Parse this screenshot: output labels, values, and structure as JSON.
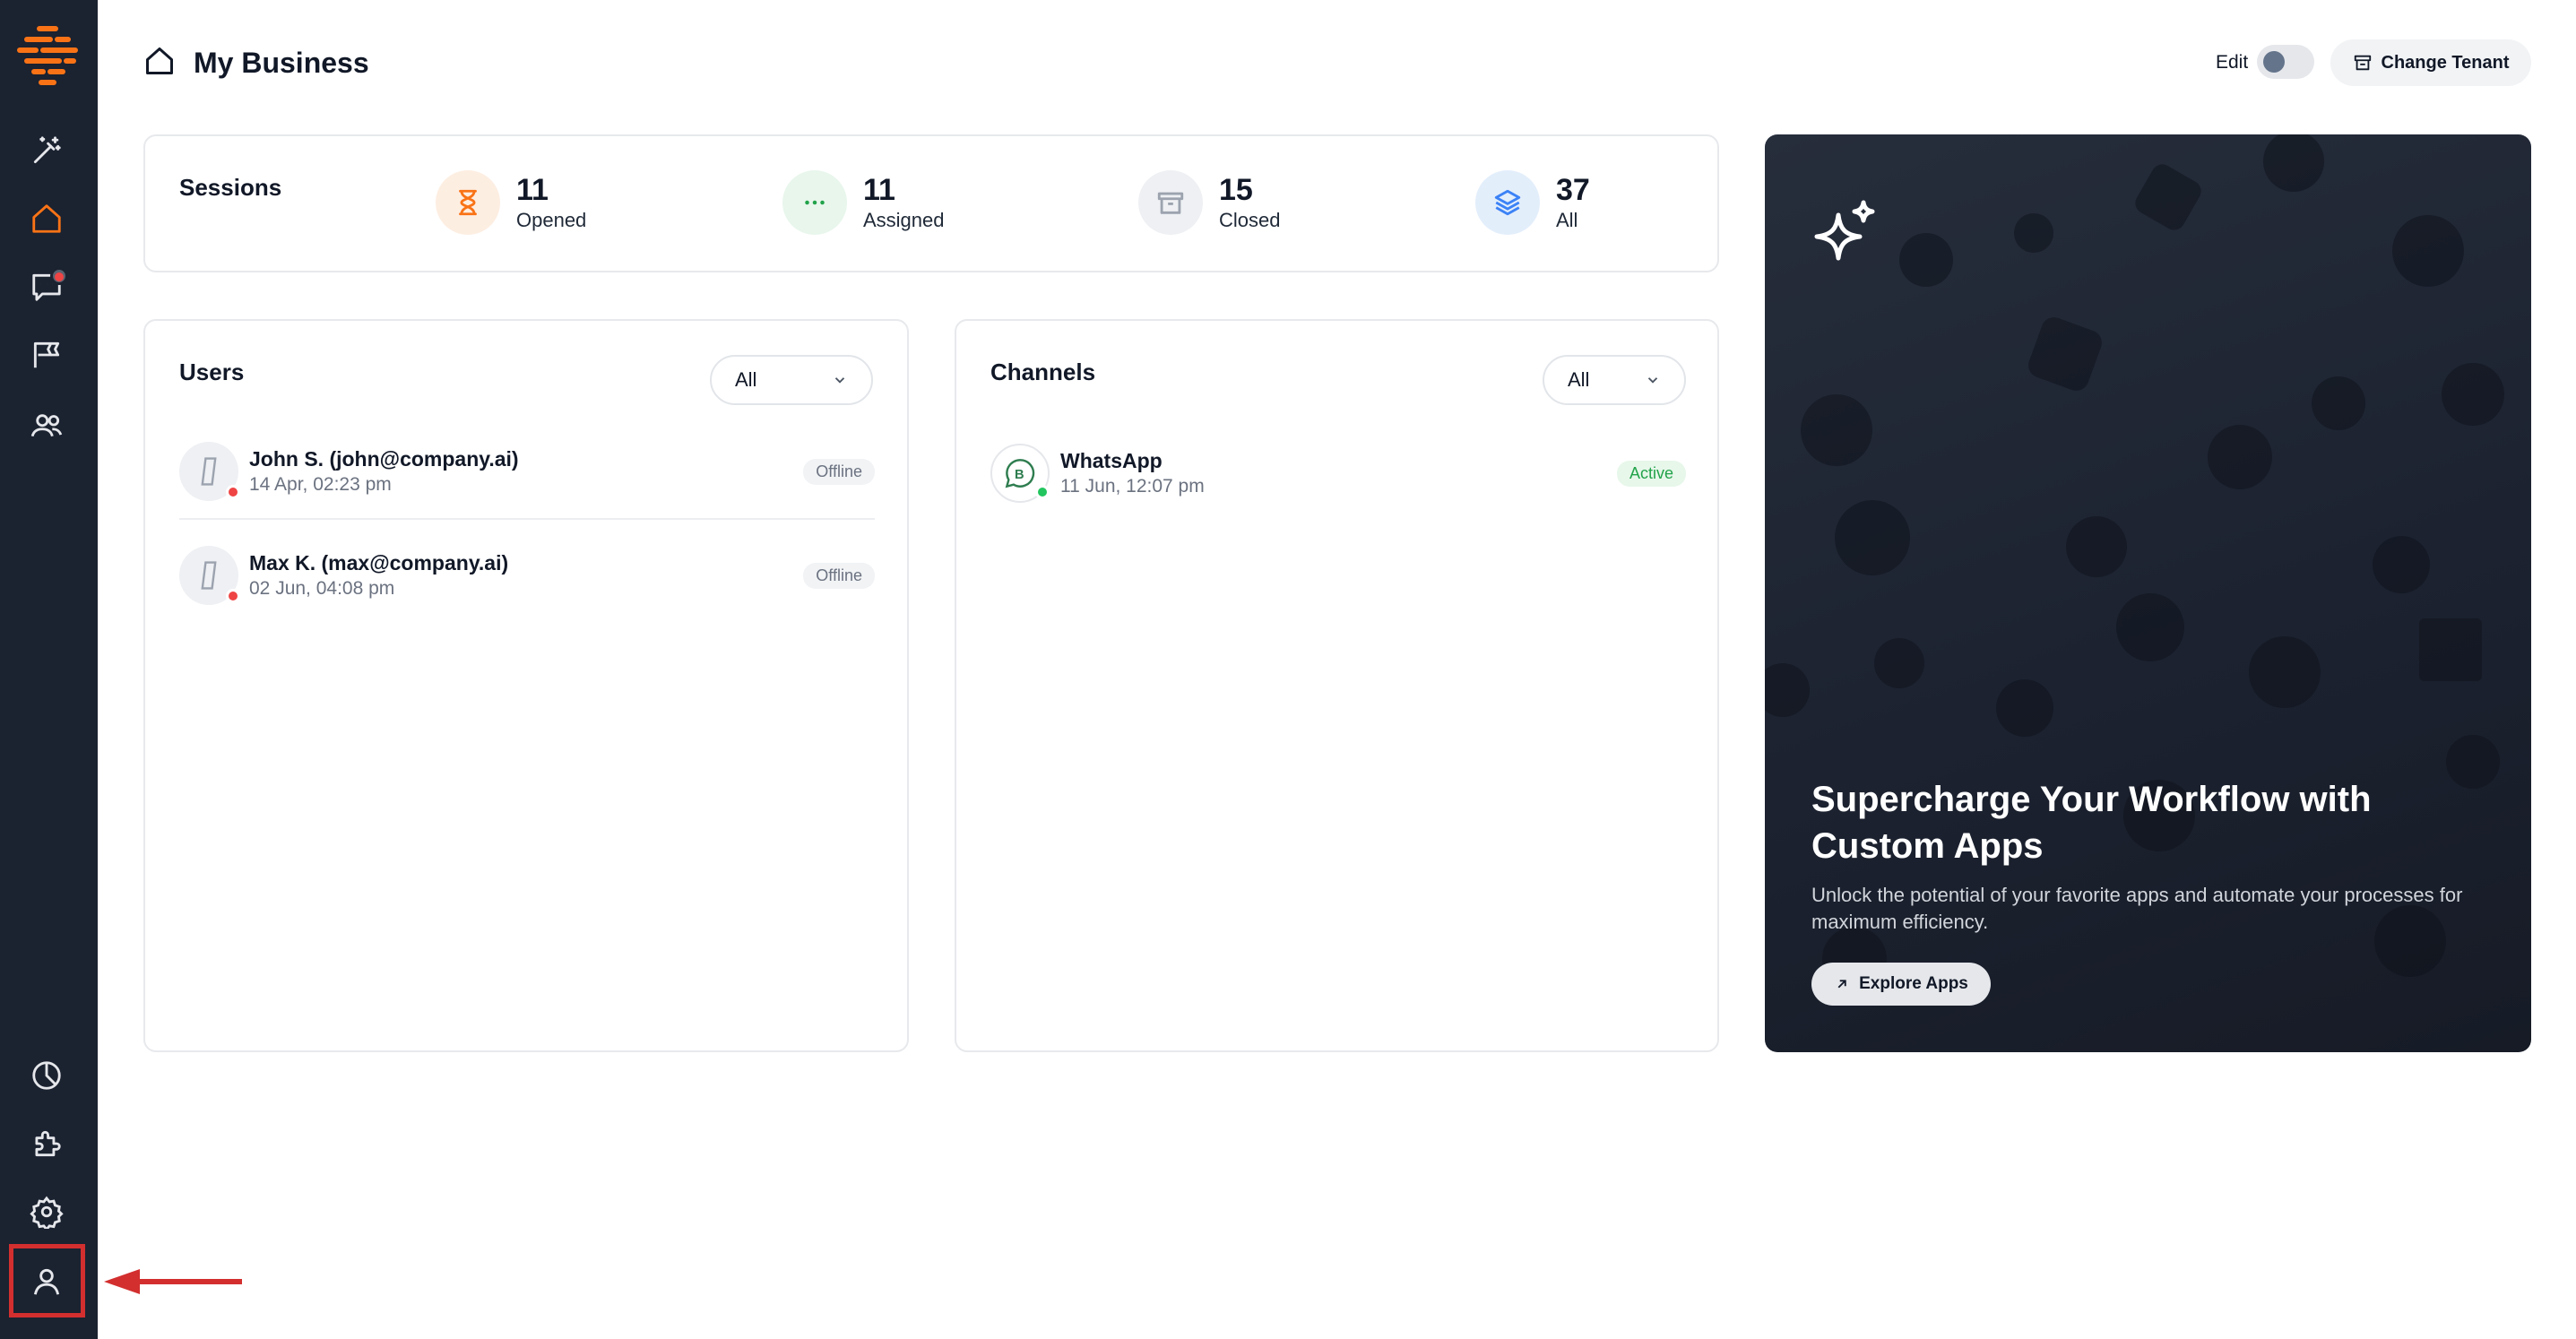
{
  "header": {
    "title": "My Business",
    "edit_label": "Edit",
    "change_tenant_label": "Change Tenant"
  },
  "sessions": {
    "label": "Sessions",
    "stats": [
      {
        "value": "11",
        "label": "Opened"
      },
      {
        "value": "11",
        "label": "Assigned"
      },
      {
        "value": "15",
        "label": "Closed"
      },
      {
        "value": "37",
        "label": "All"
      }
    ]
  },
  "users": {
    "title": "Users",
    "filter": "All",
    "items": [
      {
        "name": "John S. (john@company.ai)",
        "date": "14 Apr, 02:23 pm",
        "status": "Offline"
      },
      {
        "name": "Max K. (max@company.ai)",
        "date": "02 Jun, 04:08 pm",
        "status": "Offline"
      }
    ]
  },
  "channels": {
    "title": "Channels",
    "filter": "All",
    "items": [
      {
        "name": "WhatsApp",
        "date": "11 Jun, 12:07 pm",
        "status": "Active"
      }
    ]
  },
  "promo": {
    "title": "Supercharge Your Workflow with Custom Apps",
    "description": "Unlock the potential of your favorite apps and automate your processes for maximum efficiency.",
    "button_label": "Explore Apps"
  },
  "colors": {
    "accent": "#f97316",
    "sidebar": "#1b2230",
    "offline": "#ef4444",
    "online": "#22c55e",
    "highlight": "#d32f2f"
  }
}
